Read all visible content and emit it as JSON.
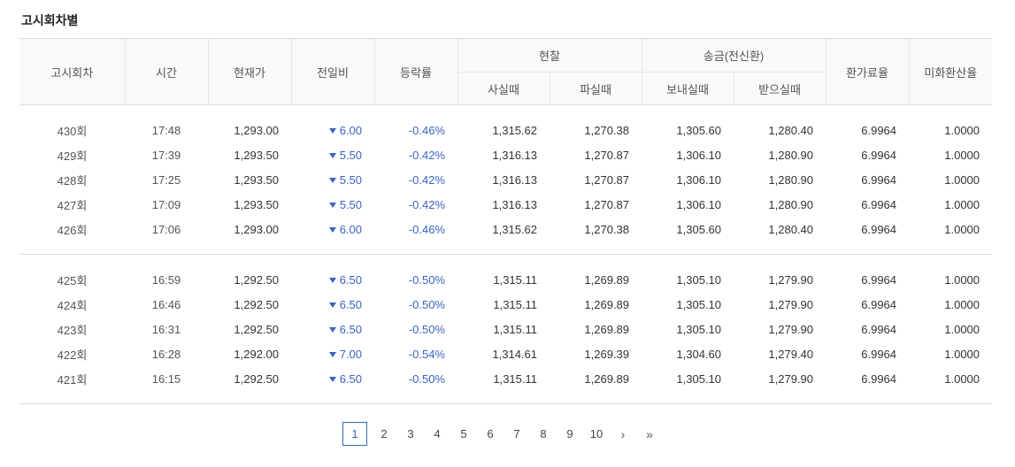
{
  "section_title": "고시회차별",
  "headers": {
    "round": "고시회차",
    "time": "시간",
    "current": "현재가",
    "change": "전일비",
    "rate": "등락률",
    "cash": "현찰",
    "cash_buy": "사실때",
    "cash_sell": "파실때",
    "remit": "송금(전신환)",
    "remit_send": "보내실때",
    "remit_recv": "받으실때",
    "exchange_ratio": "환가료율",
    "usd_ratio": "미화환산율"
  },
  "groups": [
    {
      "rows": [
        {
          "round": "430회",
          "time": "17:48",
          "current": "1,293.00",
          "change": "6.00",
          "rate": "-0.46%",
          "cash_buy": "1,315.62",
          "cash_sell": "1,270.38",
          "send": "1,305.60",
          "recv": "1,280.40",
          "fee": "6.9964",
          "usd": "1.0000"
        },
        {
          "round": "429회",
          "time": "17:39",
          "current": "1,293.50",
          "change": "5.50",
          "rate": "-0.42%",
          "cash_buy": "1,316.13",
          "cash_sell": "1,270.87",
          "send": "1,306.10",
          "recv": "1,280.90",
          "fee": "6.9964",
          "usd": "1.0000"
        },
        {
          "round": "428회",
          "time": "17:25",
          "current": "1,293.50",
          "change": "5.50",
          "rate": "-0.42%",
          "cash_buy": "1,316.13",
          "cash_sell": "1,270.87",
          "send": "1,306.10",
          "recv": "1,280.90",
          "fee": "6.9964",
          "usd": "1.0000"
        },
        {
          "round": "427회",
          "time": "17:09",
          "current": "1,293.50",
          "change": "5.50",
          "rate": "-0.42%",
          "cash_buy": "1,316.13",
          "cash_sell": "1,270.87",
          "send": "1,306.10",
          "recv": "1,280.90",
          "fee": "6.9964",
          "usd": "1.0000"
        },
        {
          "round": "426회",
          "time": "17:06",
          "current": "1,293.00",
          "change": "6.00",
          "rate": "-0.46%",
          "cash_buy": "1,315.62",
          "cash_sell": "1,270.38",
          "send": "1,305.60",
          "recv": "1,280.40",
          "fee": "6.9964",
          "usd": "1.0000"
        }
      ]
    },
    {
      "rows": [
        {
          "round": "425회",
          "time": "16:59",
          "current": "1,292.50",
          "change": "6.50",
          "rate": "-0.50%",
          "cash_buy": "1,315.11",
          "cash_sell": "1,269.89",
          "send": "1,305.10",
          "recv": "1,279.90",
          "fee": "6.9964",
          "usd": "1.0000"
        },
        {
          "round": "424회",
          "time": "16:46",
          "current": "1,292.50",
          "change": "6.50",
          "rate": "-0.50%",
          "cash_buy": "1,315.11",
          "cash_sell": "1,269.89",
          "send": "1,305.10",
          "recv": "1,279.90",
          "fee": "6.9964",
          "usd": "1.0000"
        },
        {
          "round": "423회",
          "time": "16:31",
          "current": "1,292.50",
          "change": "6.50",
          "rate": "-0.50%",
          "cash_buy": "1,315.11",
          "cash_sell": "1,269.89",
          "send": "1,305.10",
          "recv": "1,279.90",
          "fee": "6.9964",
          "usd": "1.0000"
        },
        {
          "round": "422회",
          "time": "16:28",
          "current": "1,292.00",
          "change": "7.00",
          "rate": "-0.54%",
          "cash_buy": "1,314.61",
          "cash_sell": "1,269.39",
          "send": "1,304.60",
          "recv": "1,279.40",
          "fee": "6.9964",
          "usd": "1.0000"
        },
        {
          "round": "421회",
          "time": "16:15",
          "current": "1,292.50",
          "change": "6.50",
          "rate": "-0.50%",
          "cash_buy": "1,315.11",
          "cash_sell": "1,269.89",
          "send": "1,305.10",
          "recv": "1,279.90",
          "fee": "6.9964",
          "usd": "1.0000"
        }
      ]
    }
  ],
  "pagination": {
    "pages": [
      "1",
      "2",
      "3",
      "4",
      "5",
      "6",
      "7",
      "8",
      "9",
      "10"
    ],
    "active": "1",
    "next_label": "›",
    "last_label": "»"
  },
  "colors": {
    "down": "#3a63c1",
    "active_page": "#2f6db5"
  }
}
